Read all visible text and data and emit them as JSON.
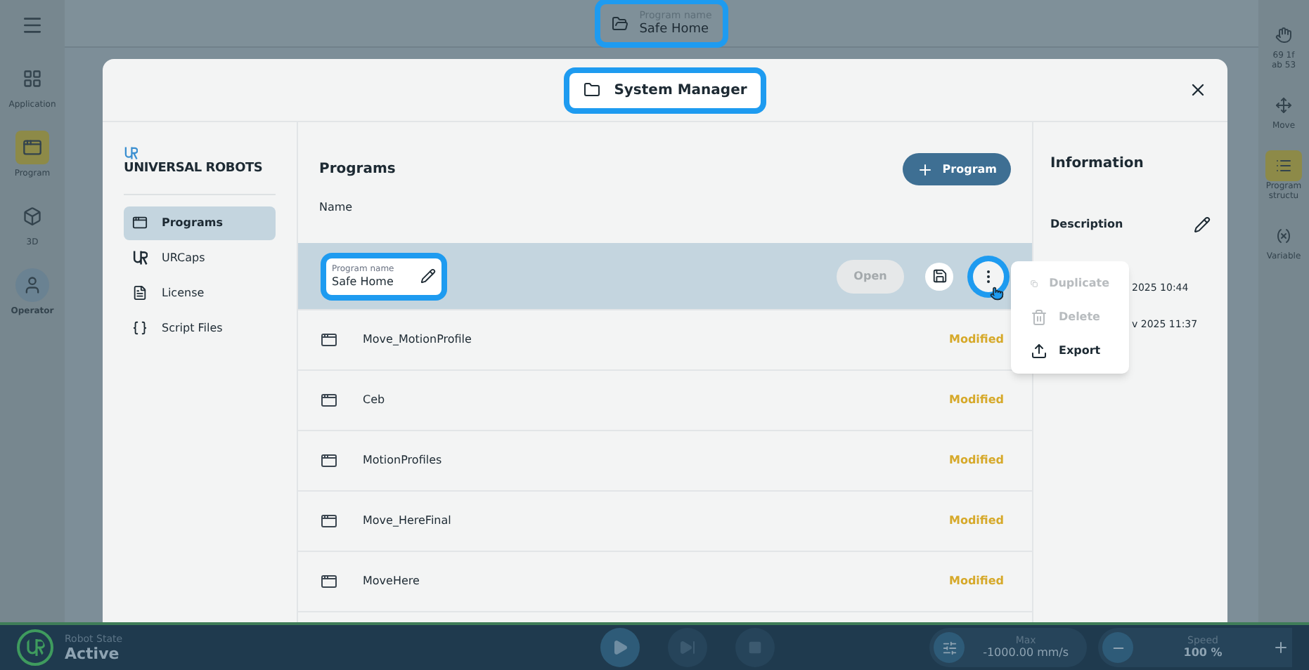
{
  "top_bar": {
    "program_field": {
      "label": "Program name",
      "value": "Safe Home",
      "highlighted": true
    }
  },
  "left_nav": [
    {
      "kind": "apps",
      "label": "Application",
      "selected": false
    },
    {
      "kind": "program",
      "label": "Program",
      "selected": true
    },
    {
      "kind": "cube",
      "label": "3D",
      "selected": false
    },
    {
      "kind": "user",
      "label": "Operator",
      "selected": false
    }
  ],
  "right_nav": [
    {
      "kind": "gripper",
      "lines": [
        "69 1f",
        "ab 53"
      ],
      "selected": false
    },
    {
      "kind": "move",
      "lines": [
        "Move"
      ],
      "selected": false
    },
    {
      "kind": "structure",
      "lines": [
        "Program",
        "structu"
      ],
      "selected": true
    },
    {
      "kind": "variable",
      "lines": [
        "Variable"
      ],
      "selected": false
    }
  ],
  "modal": {
    "title": "System Manager",
    "title_highlighted": true,
    "brand": "UNIVERSAL ROBOTS",
    "menu": [
      {
        "kind": "programs",
        "label": "Programs",
        "selected": true
      },
      {
        "kind": "urcaps",
        "label": "URCaps",
        "selected": false
      },
      {
        "kind": "license",
        "label": "License",
        "selected": false
      },
      {
        "kind": "script",
        "label": "Script Files",
        "selected": false
      }
    ],
    "list_title": "Programs",
    "new_button": "Program",
    "column": "Name",
    "rows": [
      {
        "kind": "editing",
        "field_label": "Program name",
        "value": "Safe Home",
        "field_highlighted": true,
        "open_button": "Open",
        "menu_highlighted": true,
        "selected": true
      },
      {
        "kind": "file",
        "name": "Move_MotionProfile",
        "status": "Modified",
        "selected": false
      },
      {
        "kind": "file",
        "name": "Ceb",
        "status": "Modified",
        "selected": false
      },
      {
        "kind": "file",
        "name": "MotionProfiles",
        "status": "Modified",
        "selected": false
      },
      {
        "kind": "file",
        "name": "Move_HereFinal",
        "status": "Modified",
        "selected": false
      },
      {
        "kind": "file",
        "name": "MoveHere",
        "status": "Modified",
        "selected": false
      }
    ],
    "context_menu": [
      {
        "kind": "duplicate",
        "label": "Duplicate",
        "disabled": true
      },
      {
        "kind": "delete",
        "label": "Delete",
        "disabled": true
      },
      {
        "kind": "export",
        "label": "Export",
        "disabled": false
      }
    ],
    "info": {
      "title": "Information",
      "description_label": "Description",
      "dates": [
        "2025 10:44",
        "v 2025 11:37"
      ]
    }
  },
  "bottom_bar": {
    "state_label": "Robot State",
    "state_value": "Active",
    "max_label": "Max",
    "max_value": "-1000.00 mm/s",
    "speed_label": "Speed",
    "speed_value": "100 %"
  }
}
